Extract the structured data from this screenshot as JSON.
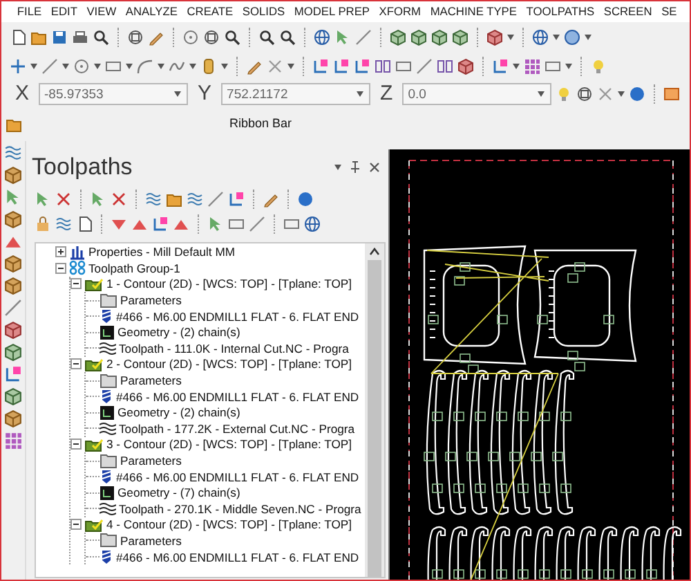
{
  "menu_bar": [
    {
      "label": "FILE"
    },
    {
      "label": "EDIT"
    },
    {
      "label": "VIEW"
    },
    {
      "label": "ANALYZE"
    },
    {
      "label": "CREATE"
    },
    {
      "label": "SOLIDS"
    },
    {
      "label": "MODEL PREP"
    },
    {
      "label": "XFORM"
    },
    {
      "label": "MACHINE TYPE"
    },
    {
      "label": "TOOLPATHS"
    },
    {
      "label": "SCREEN"
    },
    {
      "label": "SE"
    }
  ],
  "coordinates": [
    {
      "label": "X",
      "value": "-85.97353"
    },
    {
      "label": "Y",
      "value": "752.21172"
    },
    {
      "label": "Z",
      "value": "0.0"
    }
  ],
  "ribbon_bar": {
    "label": "Ribbon Bar"
  },
  "panel": {
    "title": "Toolpaths",
    "tree": [
      {
        "label": "Properties - Mill Default MM",
        "kind": "properties",
        "expanded": false
      },
      {
        "label": "Toolpath Group-1",
        "kind": "group",
        "expanded": true,
        "children": [
          {
            "label": "1 - Contour (2D) - [WCS: TOP] - [Tplane: TOP]",
            "kind": "operation",
            "expanded": true,
            "children": [
              {
                "label": "Parameters",
                "kind": "parameters"
              },
              {
                "label": "#466 - M6.00 ENDMILL1 FLAT - 6. FLAT END",
                "kind": "tool"
              },
              {
                "label": "Geometry - (2) chain(s)",
                "kind": "geometry"
              },
              {
                "label": "Toolpath - 111.0K - Internal Cut.NC - Progra",
                "kind": "toolpath"
              }
            ]
          },
          {
            "label": "2 - Contour (2D) - [WCS: TOP] - [Tplane: TOP]",
            "kind": "operation",
            "expanded": true,
            "children": [
              {
                "label": "Parameters",
                "kind": "parameters"
              },
              {
                "label": "#466 - M6.00 ENDMILL1 FLAT - 6. FLAT END",
                "kind": "tool"
              },
              {
                "label": "Geometry - (2) chain(s)",
                "kind": "geometry"
              },
              {
                "label": "Toolpath - 177.2K - External Cut.NC - Progra",
                "kind": "toolpath"
              }
            ]
          },
          {
            "label": "3 - Contour (2D) - [WCS: TOP] - [Tplane: TOP]",
            "kind": "operation",
            "expanded": true,
            "children": [
              {
                "label": "Parameters",
                "kind": "parameters"
              },
              {
                "label": "#466 - M6.00 ENDMILL1 FLAT - 6. FLAT END",
                "kind": "tool"
              },
              {
                "label": "Geometry - (7) chain(s)",
                "kind": "geometry"
              },
              {
                "label": "Toolpath - 270.1K - Middle Seven.NC - Progra",
                "kind": "toolpath"
              }
            ]
          },
          {
            "label": "4 - Contour (2D) - [WCS: TOP] - [Tplane: TOP]",
            "kind": "operation",
            "expanded": true,
            "children": [
              {
                "label": "Parameters",
                "kind": "parameters"
              },
              {
                "label": "#466 - M6.00 ENDMILL1 FLAT - 6. FLAT END",
                "kind": "tool"
              }
            ]
          }
        ]
      }
    ]
  }
}
